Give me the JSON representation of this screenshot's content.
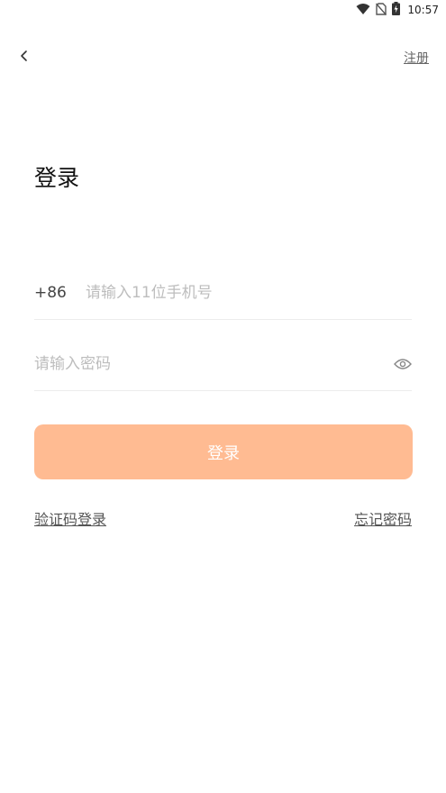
{
  "status_bar": {
    "time": "10:57",
    "icons": [
      "wifi-icon",
      "no-sim-icon",
      "battery-charging-icon"
    ]
  },
  "header": {
    "back_icon": "chevron-left-icon",
    "register_label": "注册"
  },
  "title": "登录",
  "phone": {
    "country_code": "+86",
    "value": "",
    "placeholder": "请输入11位手机号"
  },
  "password": {
    "value": "",
    "placeholder": "请输入密码",
    "toggle_icon": "eye-icon"
  },
  "login_button": {
    "label": "登录",
    "color": "#ffbb92"
  },
  "links": {
    "sms_login": "验证码登录",
    "forgot_password": "忘记密码"
  }
}
